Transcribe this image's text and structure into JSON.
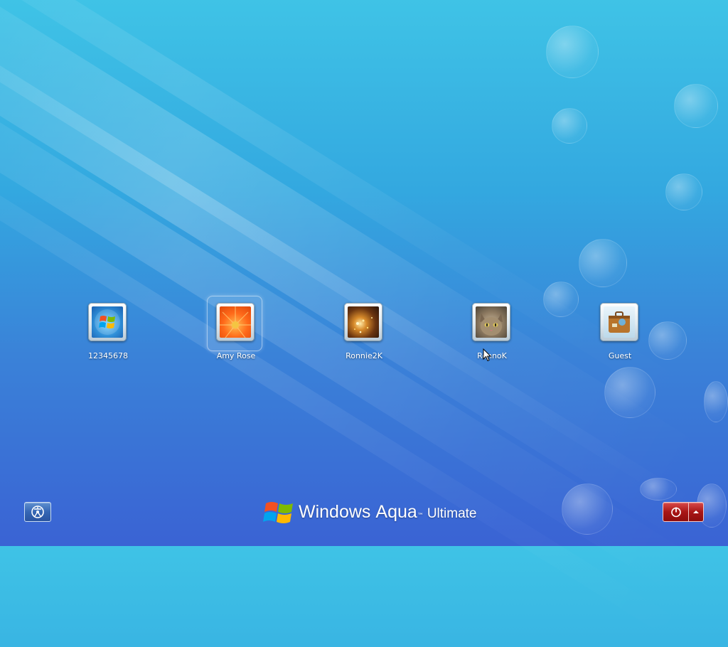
{
  "users": [
    {
      "name": "12345678",
      "picture": "windows-logo-picture",
      "selected": false
    },
    {
      "name": "Amy Rose",
      "picture": "orange-flower-picture",
      "selected": true
    },
    {
      "name": "Ronnie2K",
      "picture": "golden-sparkles-picture",
      "selected": false
    },
    {
      "name": "RonnoK",
      "picture": "kitten-picture",
      "selected": false
    },
    {
      "name": "Guest",
      "picture": "suitcase-picture",
      "selected": false
    }
  ],
  "footer": {
    "ease_of_access_icon": "ease-of-access-icon",
    "power_icon": "power-icon",
    "power_options_icon": "chevron-up-icon"
  },
  "branding": {
    "windows": "Windows",
    "aqua": "Aqua",
    "trademark": "™",
    "edition": "Ultimate"
  },
  "colors": {
    "background_top": "#3fc3e6",
    "background_bottom": "#3a63d4",
    "power_button": "#a81616",
    "ease_button": "#3566b4",
    "text": "#ffffff"
  }
}
